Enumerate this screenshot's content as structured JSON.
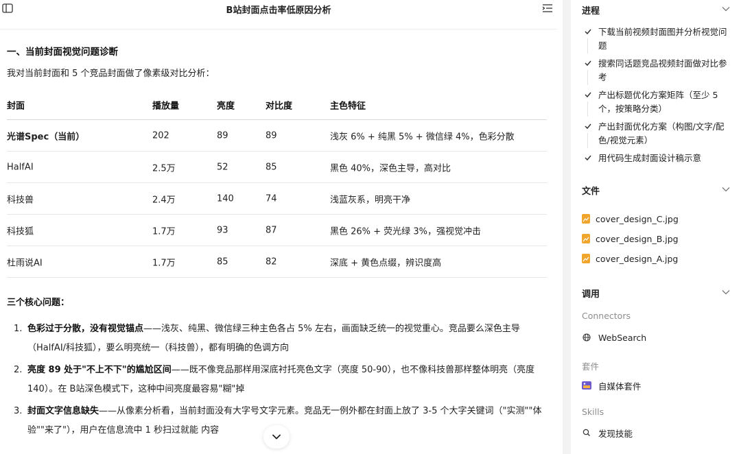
{
  "header": {
    "title": "B站封面点击率低原因分析"
  },
  "content": {
    "heading1": "一、当前封面视觉问题诊断",
    "intro": "我对当前封面和 5 个竞品封面做了像素级对比分析：",
    "table": {
      "columns": [
        "封面",
        "播放量",
        "亮度",
        "对比度",
        "主色特征"
      ],
      "rows": [
        [
          "光谱Spec（当前）",
          "202",
          "89",
          "89",
          "浅灰 6% + 纯黑 5% + 微信绿 4%，色彩分散"
        ],
        [
          "HalfAI",
          "2.5万",
          "52",
          "85",
          "黑色 40%，深色主导，高对比"
        ],
        [
          "科技兽",
          "2.4万",
          "140",
          "74",
          "浅蓝灰系，明亮干净"
        ],
        [
          "科技狐",
          "1.7万",
          "93",
          "87",
          "黑色 26% + 荧光绿 3%，强视觉冲击"
        ],
        [
          "杜雨说AI",
          "1.7万",
          "85",
          "82",
          "深底 + 黄色点缀，辨识度高"
        ]
      ]
    },
    "heading2": "三个核心问题：",
    "issues": [
      {
        "num": "1.",
        "bold": "色彩过于分散，没有视觉锚点",
        "text": "——浅灰、纯黑、微信绿三种主色各占 5% 左右，画面缺乏统一的视觉重心。竞品要么深色主导（HalfAI/科技狐），要么明亮统一（科技兽），都有明确的色调方向"
      },
      {
        "num": "2.",
        "bold": "亮度 89 处于\"不上不下\"的尴尬区间",
        "text": "——既不像竞品那样用深底衬托亮色文字（亮度 50-90），也不像科技兽那样整体明亮（亮度 140）。在 B站深色模式下，这种中间亮度最容易\"糊\"掉"
      },
      {
        "num": "3.",
        "bold": "封面文字信息缺失",
        "text": "——从像素分析看，当前封面没有大字号文字元素。竞品无一例外都在封面上放了 3-5 个大字关键词（\"实测\"\"体验\"\"来了\"），用户在信息流中 1 秒扫过就能  内容"
      }
    ]
  },
  "sidebar": {
    "progress": {
      "title": "进程",
      "tasks": [
        "下载当前视频封面图并分析视觉问题",
        "搜索同话题竞品视频封面做对比参考",
        "产出标题优化方案矩阵（至少 5 个，按策略分类）",
        "产出封面优化方案（构图/文字/配色/视觉元素）",
        "用代码生成封面设计稿示意"
      ]
    },
    "files": {
      "title": "文件",
      "items": [
        "cover_design_C.jpg",
        "cover_design_B.jpg",
        "cover_design_A.jpg"
      ]
    },
    "calls": {
      "title": "调用",
      "connectors_label": "Connectors",
      "connectors": [
        "WebSearch"
      ],
      "suites_label": "套件",
      "suites": [
        "自媒体套件"
      ],
      "skills_label": "Skills",
      "skills": [
        "发现技能"
      ]
    }
  },
  "colors": {
    "accent_file": "#f0a52c",
    "panel_gray": "#f3f3f3"
  }
}
